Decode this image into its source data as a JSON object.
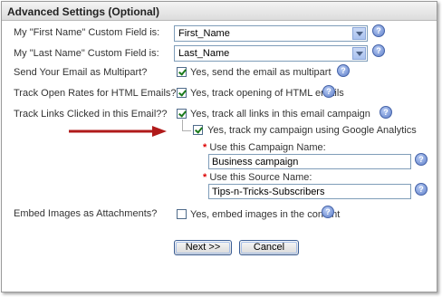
{
  "section_title": "Advanced Settings (Optional)",
  "fields": {
    "first_name": {
      "label": "My \"First Name\" Custom Field is:",
      "value": "First_Name"
    },
    "last_name": {
      "label": "My \"Last Name\" Custom Field is:",
      "value": "Last_Name"
    },
    "multipart": {
      "label": "Send Your Email as Multipart?",
      "checkbox_label": "Yes, send the email as multipart",
      "checked": true
    },
    "track_opens": {
      "label": "Track Open Rates for HTML Emails?",
      "checkbox_label": "Yes, track opening of HTML emails",
      "checked": true
    },
    "track_links": {
      "label": "Track Links Clicked in this Email??",
      "checkbox_label": "Yes, track all links in this email campaign",
      "checked": true
    },
    "google_analytics": {
      "checkbox_label": "Yes, track my campaign using Google Analytics",
      "checked": true
    },
    "campaign_name": {
      "required_mark": "*",
      "label": "Use this Campaign Name:",
      "value": "Business campaign"
    },
    "source_name": {
      "required_mark": "*",
      "label": "Use this Source Name:",
      "value": "Tips-n-Tricks-Subscribers"
    },
    "embed_images": {
      "label": "Embed Images as Attachments?",
      "checkbox_label": "Yes, embed images in the content",
      "checked": false
    }
  },
  "buttons": {
    "next": "Next >>",
    "cancel": "Cancel"
  },
  "help_glyph": "?",
  "colors": {
    "arrow": "#b01a1a",
    "required": "#dd0000",
    "help_icon": "#5f7fc9"
  }
}
